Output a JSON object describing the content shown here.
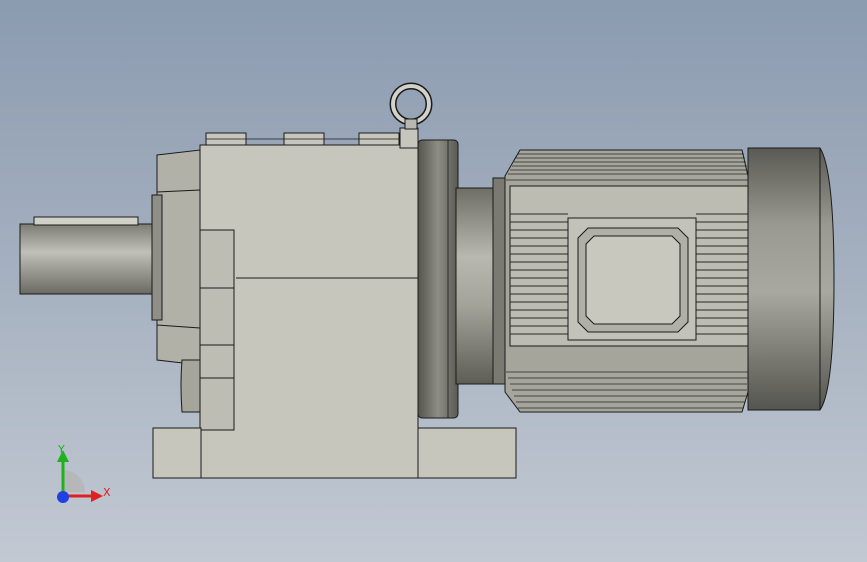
{
  "triad": {
    "x_label": "X",
    "y_label": "Y",
    "colors": {
      "x": "#e02020",
      "y": "#20b020",
      "z": "#2040e0"
    }
  },
  "colors": {
    "background_top": "#8b9bb0",
    "background_bottom": "#c2c9d3",
    "housing": "#c6c6bd",
    "housing_dark": "#a9a9a0",
    "outline": "#1a1a1a"
  }
}
